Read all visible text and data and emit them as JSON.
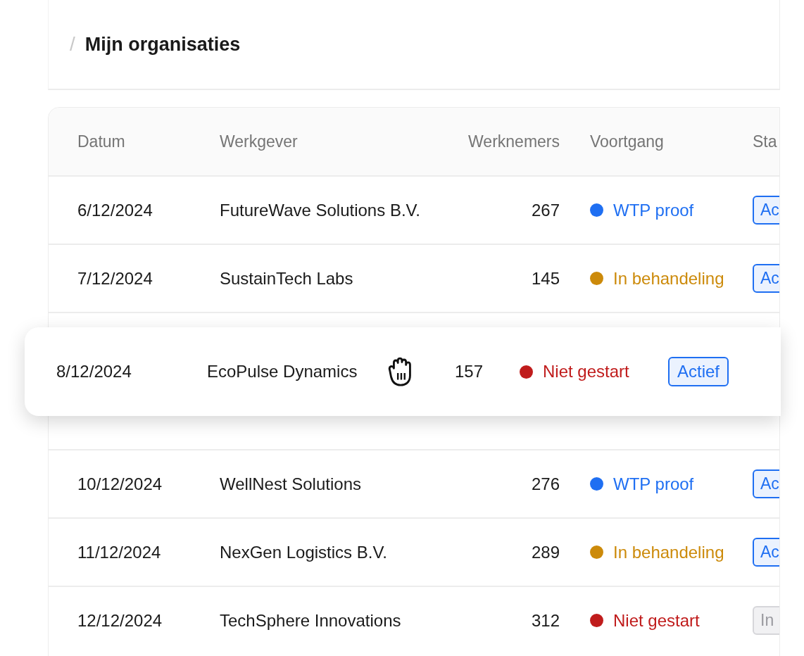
{
  "breadcrumb": {
    "separator": "/",
    "title": "Mijn organisaties"
  },
  "table": {
    "columns": [
      "Datum",
      "Werkgever",
      "Werknemers",
      "Voortgang",
      "Sta"
    ],
    "rows": [
      {
        "kind": "row",
        "date": "6/12/2024",
        "employer": "FutureWave Solutions B.V.",
        "employees": "267",
        "progress": {
          "label": "WTP proof",
          "color": "#1f6ff2"
        },
        "status": {
          "label": "Ac",
          "active": true
        }
      },
      {
        "kind": "row",
        "date": "7/12/2024",
        "employer": "SustainTech Labs",
        "employees": "145",
        "progress": {
          "label": "In behandeling",
          "color": "#cc8a0a"
        },
        "status": {
          "label": "Ac",
          "active": true
        }
      },
      {
        "kind": "drop_slot"
      },
      {
        "kind": "row",
        "date": "10/12/2024",
        "employer": "WellNest Solutions",
        "employees": "276",
        "progress": {
          "label": "WTP proof",
          "color": "#1f6ff2"
        },
        "status": {
          "label": "Ac",
          "active": true
        }
      },
      {
        "kind": "row",
        "date": "11/12/2024",
        "employer": "NexGen Logistics B.V.",
        "employees": "289",
        "progress": {
          "label": "In behandeling",
          "color": "#cc8a0a"
        },
        "status": {
          "label": "Ac",
          "active": true
        }
      },
      {
        "kind": "row",
        "date": "12/12/2024",
        "employer": "TechSphere Innovations",
        "employees": "312",
        "progress": {
          "label": "Niet gestart",
          "color": "#c01c1c"
        },
        "status": {
          "label": "In",
          "active": false
        }
      }
    ]
  },
  "dragged_row": {
    "date": "8/12/2024",
    "employer": "EcoPulse Dynamics",
    "employees": "157",
    "progress": {
      "label": "Niet gestart",
      "color": "#c01c1c"
    },
    "status": {
      "label": "Actief",
      "active": true
    }
  }
}
